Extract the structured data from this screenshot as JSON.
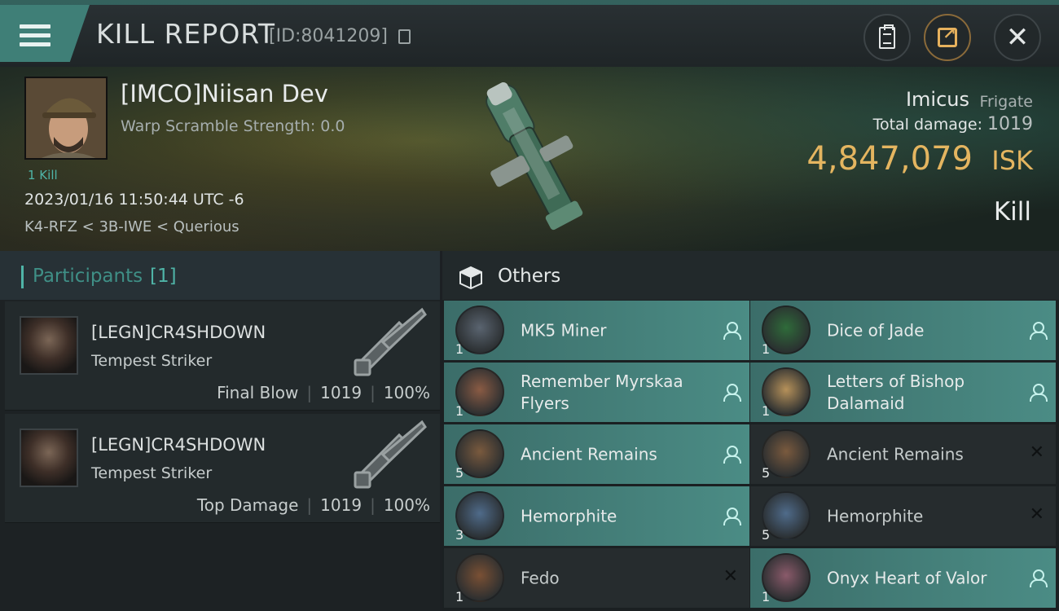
{
  "header": {
    "title": "KILL REPORT",
    "report_id": "[ID:8041209]",
    "icons": [
      "menu-icon",
      "copy-icon",
      "clipboard-icon",
      "share-icon",
      "close-icon"
    ]
  },
  "victim": {
    "name": "[IMCO]Niisan Dev",
    "warp_scramble": "Warp Scramble Strength: 0.0",
    "kill_count": "1 Kill",
    "datetime": "2023/01/16 11:50:44 UTC -6",
    "location": "K4-RFZ < 3B-IWE < Querious",
    "ship_name": "Imicus",
    "ship_class": "Frigate",
    "total_damage_label": "Total damage:",
    "total_damage": "1019",
    "isk_value": "4,847,079",
    "isk_unit": "ISK",
    "report_type": "Kill"
  },
  "participants": {
    "title": "Participants",
    "count": "[1]",
    "rows": [
      {
        "name": "[LEGN]CR4SHDOWN",
        "ship": "Tempest Striker",
        "role": "Final Blow",
        "damage": "1019",
        "percent": "100%"
      },
      {
        "name": "[LEGN]CR4SHDOWN",
        "ship": "Tempest Striker",
        "role": "Top Damage",
        "damage": "1019",
        "percent": "100%"
      }
    ]
  },
  "others": {
    "title": "Others",
    "items": [
      {
        "name": "MK5 Miner",
        "qty": "1",
        "status": "dropped"
      },
      {
        "name": "Dice of Jade",
        "qty": "1",
        "status": "dropped"
      },
      {
        "name": "Remember Myrskaa Flyers",
        "qty": "1",
        "status": "dropped"
      },
      {
        "name": "Letters of Bishop Dalamaid",
        "qty": "1",
        "status": "dropped"
      },
      {
        "name": "Ancient Remains",
        "qty": "5",
        "status": "dropped"
      },
      {
        "name": "Ancient Remains",
        "qty": "5",
        "status": "destroyed"
      },
      {
        "name": "Hemorphite",
        "qty": "3",
        "status": "dropped"
      },
      {
        "name": "Hemorphite",
        "qty": "5",
        "status": "destroyed"
      },
      {
        "name": "Fedo",
        "qty": "1",
        "status": "destroyed"
      },
      {
        "name": "Onyx Heart of Valor",
        "qty": "1",
        "status": "dropped"
      }
    ]
  },
  "colors": {
    "accent_teal": "#4fb4a7",
    "isk_gold": "#e4b560",
    "dropped_bg": "#4b8c85",
    "destroyed_bg": "#262c2e"
  }
}
